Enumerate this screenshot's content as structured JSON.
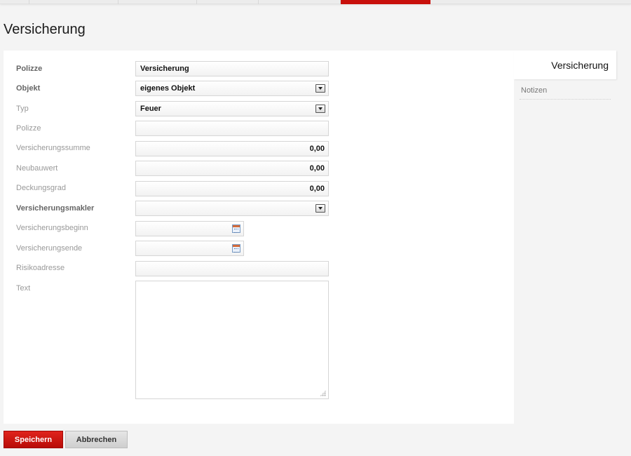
{
  "page": {
    "title": "Versicherung"
  },
  "form": {
    "polizze_name": {
      "label": "Polizze",
      "value": "Versicherung"
    },
    "objekt": {
      "label": "Objekt",
      "value": "eigenes Objekt"
    },
    "typ": {
      "label": "Typ",
      "value": "Feuer"
    },
    "polizze": {
      "label": "Polizze",
      "value": ""
    },
    "versicherungssumme": {
      "label": "Versicherungssumme",
      "value": "0,00"
    },
    "neubauwert": {
      "label": "Neubauwert",
      "value": "0,00"
    },
    "deckungsgrad": {
      "label": "Deckungsgrad",
      "value": "0,00"
    },
    "versicherungsmakler": {
      "label": "Versicherungsmakler",
      "value": ""
    },
    "versicherungsbeginn": {
      "label": "Versicherungsbeginn",
      "value": ""
    },
    "versicherungsende": {
      "label": "Versicherungsende",
      "value": ""
    },
    "risikoadresse": {
      "label": "Risikoadresse",
      "value": ""
    },
    "text": {
      "label": "Text",
      "value": ""
    }
  },
  "side_tabs": {
    "active": "Versicherung",
    "items": [
      "Notizen"
    ]
  },
  "buttons": {
    "save": "Speichern",
    "cancel": "Abbrechen"
  },
  "colors": {
    "accent": "#c8100c",
    "background": "#f4f4f4"
  }
}
